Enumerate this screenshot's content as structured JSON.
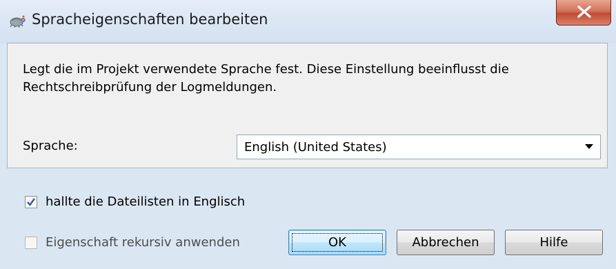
{
  "window": {
    "title": "Spracheigenschaften bearbeiten",
    "icon": "tortoise-icon",
    "close_icon": "close-x-icon"
  },
  "panel": {
    "description": "Legt die im Projekt verwendete Sprache fest. Diese Einstellung beeinflusst die Rechtschreibprüfung der Logmeldungen.",
    "language_label": "Sprache:",
    "language_value": "English (United States)"
  },
  "options": {
    "english_filelists": {
      "label": "hallte die Dateilisten in Englisch",
      "checked": true
    },
    "recursive": {
      "label": "Eigenschaft rekursiv anwenden",
      "checked": false
    }
  },
  "buttons": {
    "ok": "OK",
    "cancel": "Abbrechen",
    "help": "Hilfe"
  },
  "colors": {
    "window_bg": "#dbe6f3",
    "panel_bg": "#f0f0f0",
    "close_button": "#c14a33",
    "default_button": "#bee6fd"
  }
}
